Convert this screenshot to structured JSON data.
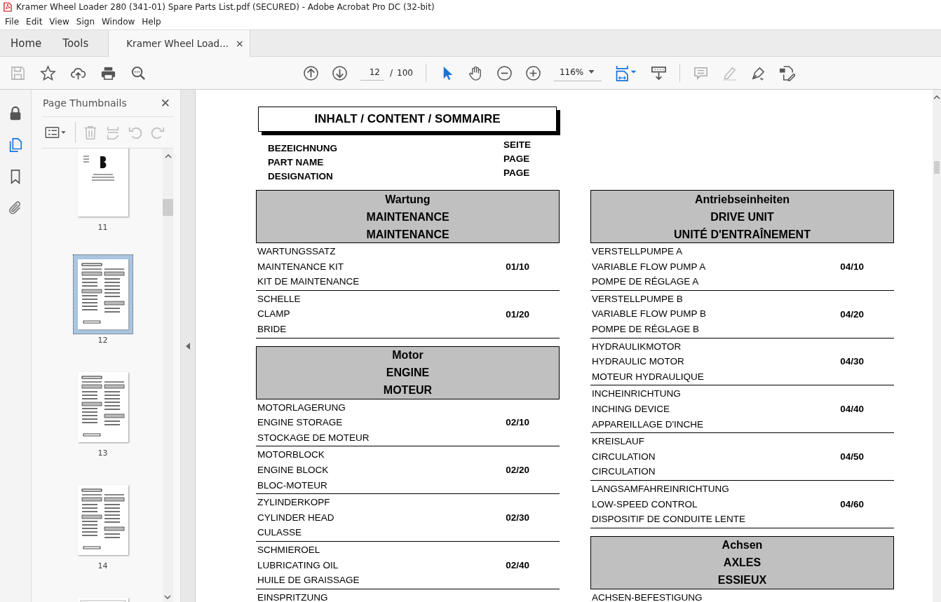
{
  "window": {
    "title": "Kramer Wheel Loader 280 (341-01) Spare Parts List.pdf (SECURED) - Adobe Acrobat Pro DC (32-bit)"
  },
  "menu": [
    "File",
    "Edit",
    "View",
    "Sign",
    "Window",
    "Help"
  ],
  "tabs": [
    {
      "label": "Home",
      "selected": false
    },
    {
      "label": "Tools",
      "selected": false
    },
    {
      "label": "Kramer Wheel Load...",
      "selected": true,
      "close": "×"
    }
  ],
  "toolbar": {
    "page_current": "12",
    "page_separator": "/",
    "page_total": "100",
    "zoom": "116%"
  },
  "sidebar": {
    "title": "Page Thumbnails",
    "close": "✕",
    "thumbnails": [
      {
        "kind": "cover",
        "label": "11",
        "selected": false
      },
      {
        "kind": "list",
        "label": "12",
        "selected": true
      },
      {
        "kind": "list",
        "label": "13",
        "selected": false
      },
      {
        "kind": "list",
        "label": "14",
        "selected": false
      },
      {
        "kind": "drawing",
        "selected": false
      }
    ]
  },
  "document": {
    "title": "INHALT / CONTENT / SOMMAIRE",
    "headings": {
      "names": [
        "BEZEICHNUNG",
        "PART NAME",
        "DESIGNATION"
      ],
      "pages": [
        "SEITE",
        "PAGE",
        "PAGE"
      ]
    },
    "columns": [
      [
        {
          "kind": "header",
          "lines": [
            "Wartung",
            "MAINTENANCE",
            "MAINTENANCE"
          ]
        },
        {
          "kind": "item",
          "lines": [
            "WARTUNGSSATZ",
            "MAINTENANCE KIT",
            "KIT DE MAINTENANCE"
          ],
          "page": "01/10"
        },
        {
          "kind": "item",
          "lines": [
            "SCHELLE",
            "CLAMP",
            "BRIDE"
          ],
          "page": "01/20"
        },
        {
          "kind": "header",
          "lines": [
            "Motor",
            "ENGINE",
            "MOTEUR"
          ]
        },
        {
          "kind": "item",
          "lines": [
            "MOTORLAGERUNG",
            "ENGINE STORAGE",
            "STOCKAGE DE MOTEUR"
          ],
          "page": "02/10"
        },
        {
          "kind": "item",
          "lines": [
            "MOTORBLOCK",
            "ENGINE BLOCK",
            "BLOC-MOTEUR"
          ],
          "page": "02/20"
        },
        {
          "kind": "item",
          "lines": [
            "ZYLINDERKOPF",
            "CYLINDER HEAD",
            "CULASSE"
          ],
          "page": "02/30"
        },
        {
          "kind": "item",
          "lines": [
            "SCHMIEROEL",
            "LUBRICATING OIL",
            "HUILE DE GRAISSAGE"
          ],
          "page": "02/40"
        },
        {
          "kind": "item",
          "lines": [
            "EINSPRITZUNG"
          ]
        }
      ],
      [
        {
          "kind": "header",
          "lines": [
            "Antriebseinheiten",
            "DRIVE UNIT",
            "UNITÉ D'ENTRAÎNEMENT"
          ]
        },
        {
          "kind": "item",
          "lines": [
            "VERSTELLPUMPE A",
            "VARIABLE FLOW PUMP A",
            "POMPE DE RÉGLAGE A"
          ],
          "page": "04/10"
        },
        {
          "kind": "item",
          "lines": [
            "VERSTELLPUMPE B",
            "VARIABLE FLOW PUMP B",
            "POMPE DE RÉGLAGE B"
          ],
          "page": "04/20"
        },
        {
          "kind": "item",
          "lines": [
            "HYDRAULIKMOTOR",
            "HYDRAULIC MOTOR",
            "MOTEUR HYDRAULIQUE"
          ],
          "page": "04/30"
        },
        {
          "kind": "item",
          "lines": [
            "INCHEINRICHTUNG",
            "INCHING DEVICE",
            "APPAREILLAGE D'INCHE"
          ],
          "page": "04/40"
        },
        {
          "kind": "item",
          "lines": [
            "KREISLAUF",
            "CIRCULATION",
            "CIRCULATION"
          ],
          "page": "04/50"
        },
        {
          "kind": "item",
          "lines": [
            "LANGSAMFAHREINRICHTUNG",
            "LOW-SPEED CONTROL",
            "DISPOSITIF DE CONDUITE LENTE"
          ],
          "page": "04/60"
        },
        {
          "kind": "header",
          "lines": [
            "Achsen",
            "AXLES",
            "ESSIEUX"
          ]
        },
        {
          "kind": "item",
          "lines": [
            "ACHSEN-BEFESTIGUNG"
          ]
        }
      ]
    ]
  }
}
